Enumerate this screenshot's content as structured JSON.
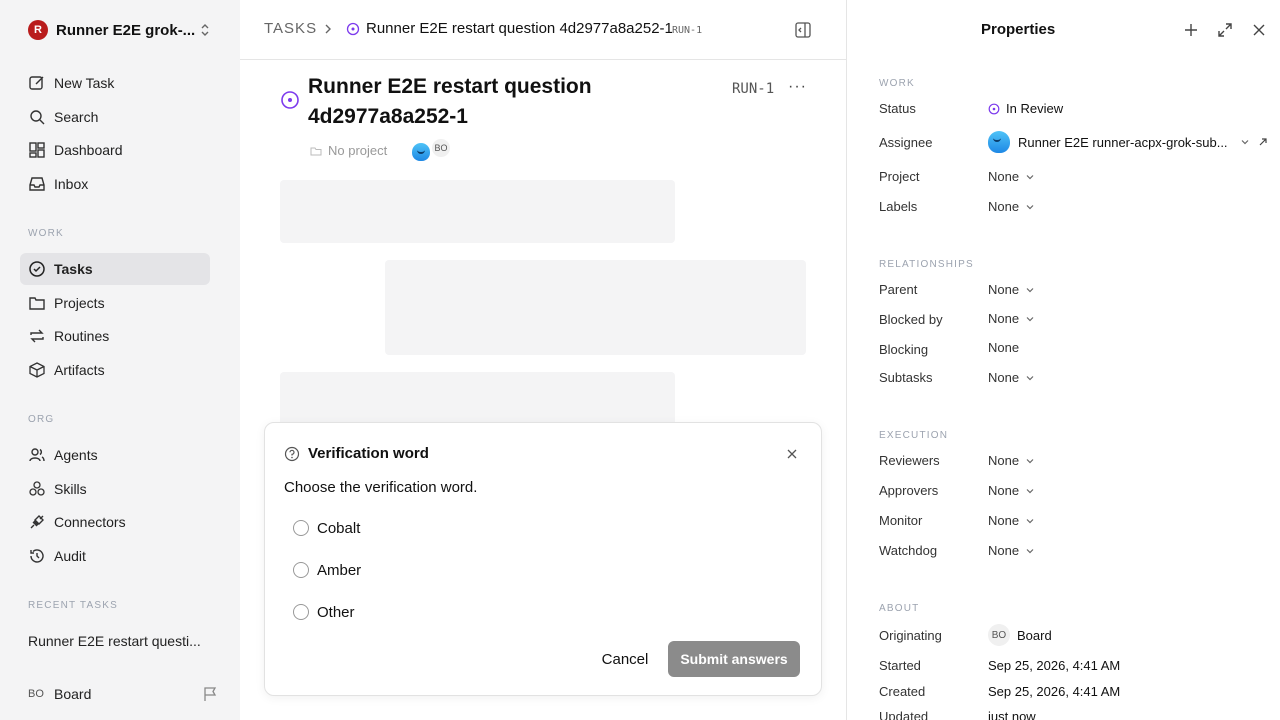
{
  "workspace": {
    "logo_letter": "R",
    "name": "Runner E2E grok-..."
  },
  "sidebar": {
    "top_items": [
      {
        "label": "New Task",
        "icon": "pencil-square-icon"
      },
      {
        "label": "Search",
        "icon": "search-icon"
      },
      {
        "label": "Dashboard",
        "icon": "grid-icon"
      },
      {
        "label": "Inbox",
        "icon": "inbox-icon"
      }
    ],
    "work_section": "WORK",
    "work_items": [
      {
        "label": "Tasks",
        "icon": "check-circle-icon",
        "active": true
      },
      {
        "label": "Projects",
        "icon": "folder-icon"
      },
      {
        "label": "Routines",
        "icon": "repeat-icon"
      },
      {
        "label": "Artifacts",
        "icon": "box-icon"
      }
    ],
    "org_section": "ORG",
    "org_items": [
      {
        "label": "Agents",
        "icon": "users-icon"
      },
      {
        "label": "Skills",
        "icon": "shapes-icon"
      },
      {
        "label": "Connectors",
        "icon": "plug-icon"
      },
      {
        "label": "Audit",
        "icon": "history-icon"
      }
    ],
    "recent_section": "RECENT TASKS",
    "recent_tasks": [
      "Runner E2E restart questi..."
    ],
    "footer": {
      "avatar": "BO",
      "name": "Board"
    }
  },
  "header": {
    "crumb": "TASKS",
    "title": "Runner E2E restart question 4d2977a8a252-1",
    "id": "RUN-1"
  },
  "task": {
    "title": "Runner E2E restart question 4d2977a8a252-1",
    "id": "RUN-1",
    "more": "···",
    "project": "No project",
    "assignee_initials": "BO"
  },
  "dialog": {
    "title": "Verification word",
    "question": "Choose the verification word.",
    "options": [
      "Cobalt",
      "Amber",
      "Other"
    ],
    "cancel": "Cancel",
    "submit": "Submit answers"
  },
  "properties": {
    "title": "Properties",
    "work_section": "WORK",
    "status_label": "Status",
    "status_value": "In Review",
    "assignee_label": "Assignee",
    "assignee_value": "Runner E2E runner-acpx-grok-sub...",
    "project_label": "Project",
    "project_value": "None",
    "labels_label": "Labels",
    "labels_value": "None",
    "relationships_section": "RELATIONSHIPS",
    "parent_label": "Parent",
    "parent_value": "None",
    "blocked_by_label": "Blocked by",
    "blocked_by_value": "None",
    "blocking_label": "Blocking",
    "blocking_value": "None",
    "subtasks_label": "Subtasks",
    "subtasks_value": "None",
    "execution_section": "EXECUTION",
    "reviewers_label": "Reviewers",
    "reviewers_value": "None",
    "approvers_label": "Approvers",
    "approvers_value": "None",
    "monitor_label": "Monitor",
    "monitor_value": "None",
    "watchdog_label": "Watchdog",
    "watchdog_value": "None",
    "about_section": "ABOUT",
    "originating_label": "Originating",
    "originating_avatar": "BO",
    "originating_value": "Board",
    "started_label": "Started",
    "started_value": "Sep 25, 2026, 4:41 AM",
    "created_label": "Created",
    "created_value": "Sep 25, 2026, 4:41 AM",
    "updated_label": "Updated",
    "updated_value": "just now"
  },
  "colors": {
    "accent": "#7c3aed",
    "active_bg": "#e4e4e7",
    "submit_bg": "#8b8b8b"
  }
}
